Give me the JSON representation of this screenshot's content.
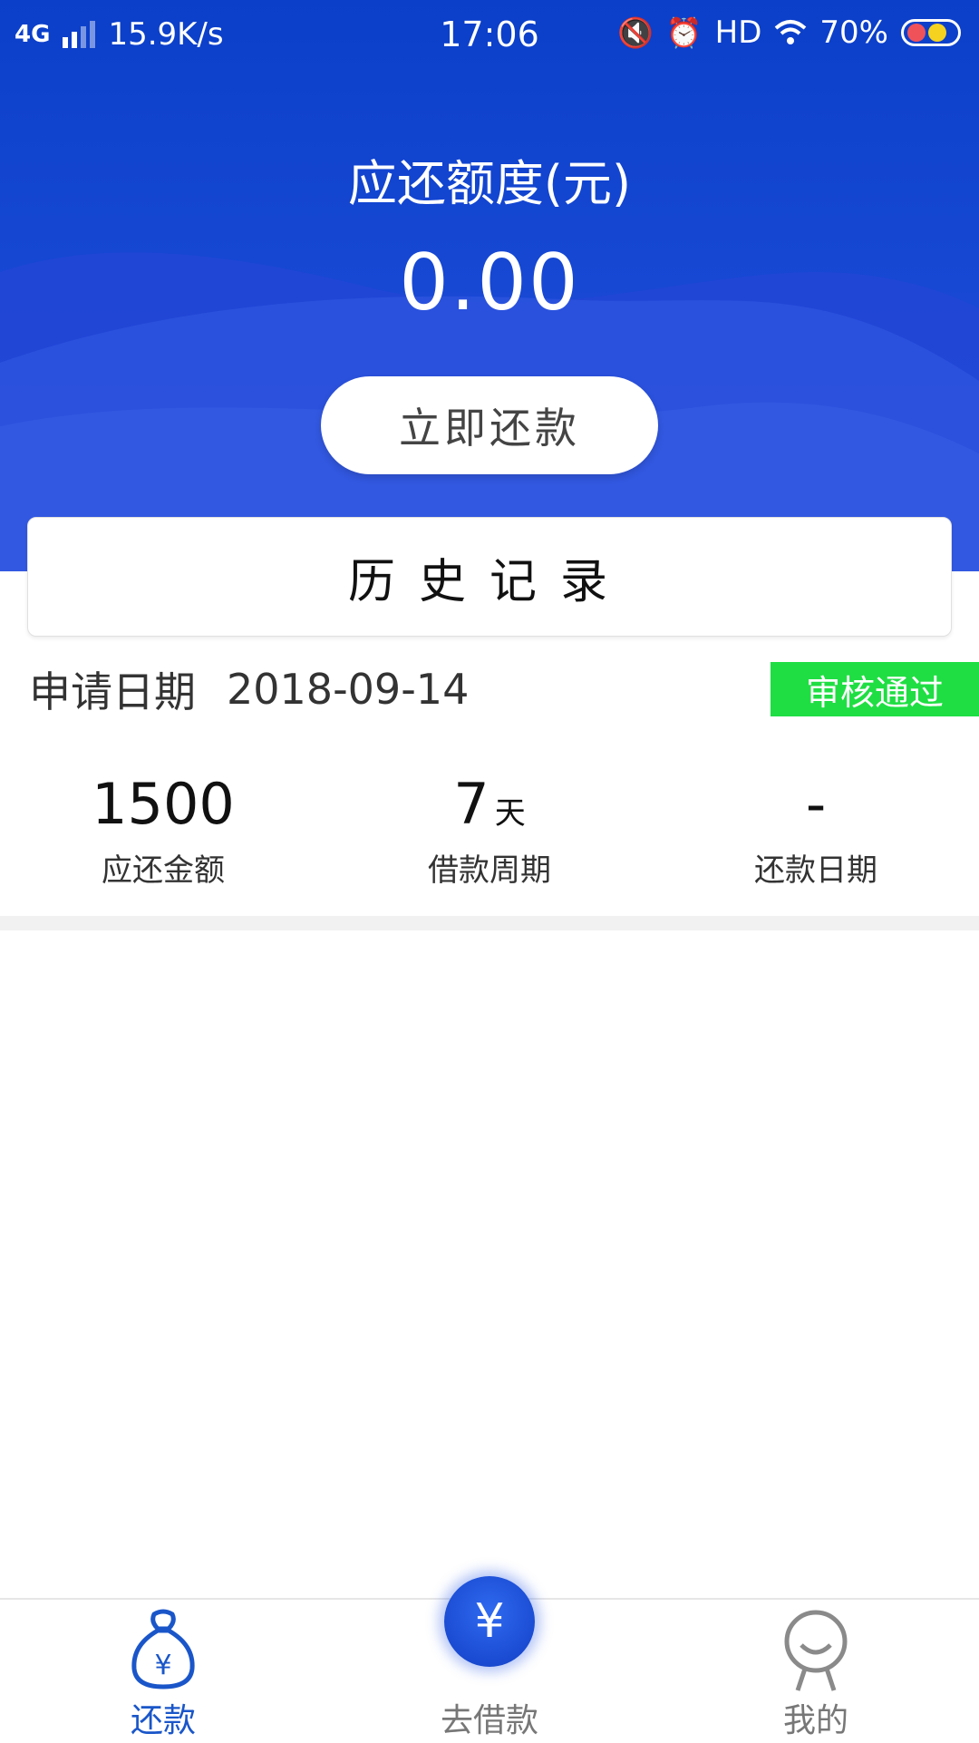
{
  "status_bar": {
    "network": "4G",
    "speed": "15.9K/s",
    "time": "17:06",
    "hd": "HD",
    "battery": "70%"
  },
  "header": {
    "due_label": "应还额度(元)",
    "due_amount": "0.00",
    "repay_button": "立即还款",
    "history_title": "历史记录"
  },
  "record": {
    "apply_label": "申请日期",
    "apply_date": "2018-09-14",
    "status": "审核通过",
    "status_color": "#1fde43",
    "stats": [
      {
        "value": "1500",
        "unit": "",
        "label": "应还金额"
      },
      {
        "value": "7",
        "unit": "天",
        "label": "借款周期"
      },
      {
        "value": "-",
        "unit": "",
        "label": "还款日期"
      }
    ]
  },
  "tabbar": {
    "repay": "还款",
    "borrow": "去借款",
    "borrow_symbol": "¥",
    "mine": "我的",
    "active_color": "#1a56c9"
  }
}
